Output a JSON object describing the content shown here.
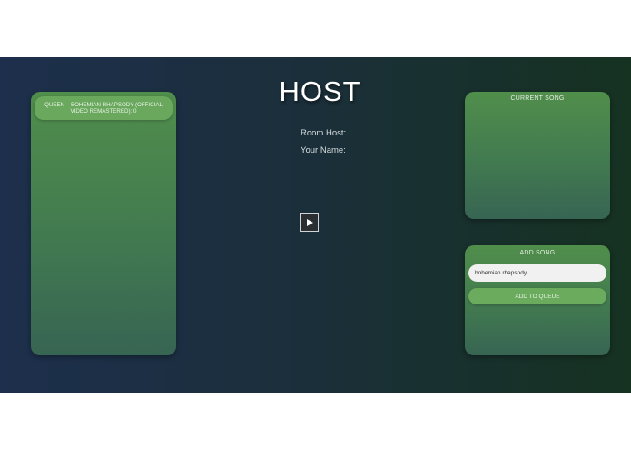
{
  "page": {
    "title": "HOST"
  },
  "queue": {
    "items": [
      {
        "label": "QUEEN – BOHEMIAN RHAPSODY (OFFICIAL VIDEO REMASTERED): 0"
      }
    ]
  },
  "room": {
    "host_label": "Room Host:",
    "name_label": "Your Name:"
  },
  "player": {
    "play_icon": "play-icon"
  },
  "current_song": {
    "heading": "CURRENT SONG"
  },
  "add_song": {
    "heading": "ADD SONG",
    "input_value": "bohemian rhapsody",
    "button_label": "ADD TO QUEUE"
  },
  "colors": {
    "background_left": "#1d2f4c",
    "background_right": "#163221",
    "panel_top": "#508e4b",
    "panel_bottom": "#376553",
    "accent_green": "#6aa85e"
  }
}
